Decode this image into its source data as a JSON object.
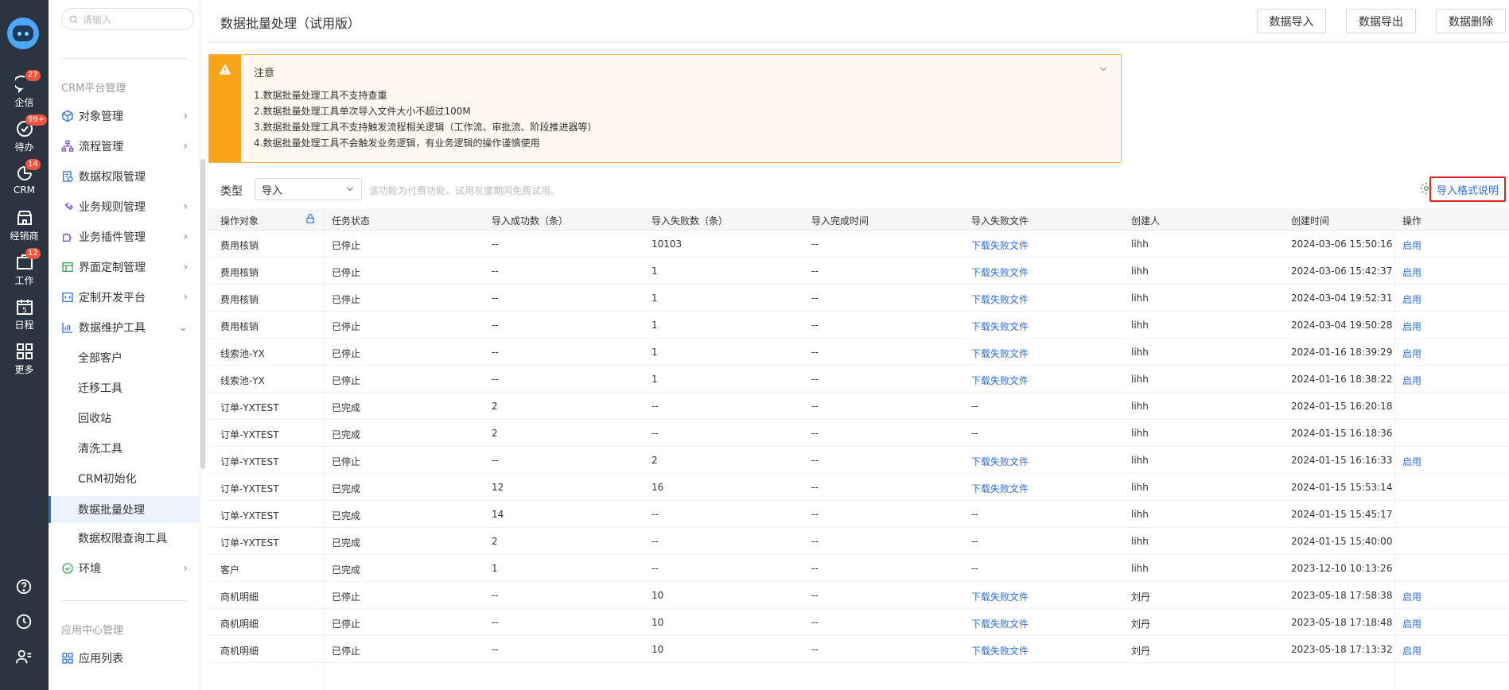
{
  "rail": {
    "items": [
      {
        "label": "企信",
        "badge": "27",
        "icon": "chat-icon"
      },
      {
        "label": "待办",
        "badge": "99+",
        "icon": "check-circle-icon"
      },
      {
        "label": "CRM",
        "badge": "14",
        "icon": "crm-icon"
      },
      {
        "label": "经销商",
        "badge": "",
        "icon": "store-icon"
      },
      {
        "label": "工作",
        "badge": "12",
        "icon": "briefcase-icon"
      },
      {
        "label": "日程",
        "badge": "",
        "icon": "calendar-icon",
        "day": "5"
      },
      {
        "label": "更多",
        "badge": "",
        "icon": "grid-icon"
      }
    ]
  },
  "sidebar": {
    "search_placeholder": "请输入",
    "group1": "CRM平台管理",
    "items": [
      {
        "label": "对象管理",
        "icon": "cube-icon",
        "chev": "›"
      },
      {
        "label": "流程管理",
        "icon": "flow-icon",
        "chev": "›"
      },
      {
        "label": "数据权限管理",
        "icon": "permission-icon",
        "chev": ""
      },
      {
        "label": "业务规则管理",
        "icon": "wrench-icon",
        "chev": "›"
      },
      {
        "label": "业务插件管理",
        "icon": "puzzle-icon",
        "chev": "›"
      },
      {
        "label": "界面定制管理",
        "icon": "layout-icon",
        "chev": "›"
      },
      {
        "label": "定制开发平台",
        "icon": "code-icon",
        "chev": "›"
      },
      {
        "label": "数据维护工具",
        "icon": "chart-icon",
        "chev": "⌄"
      }
    ],
    "subitems": [
      "全部客户",
      "迁移工具",
      "回收站",
      "清洗工具",
      "CRM初始化",
      "数据批量处理",
      "数据权限查询工具"
    ],
    "env": {
      "label": "环境",
      "chev": "›"
    },
    "group2": "应用中心管理",
    "app_list": "应用列表"
  },
  "header": {
    "title": "数据批量处理（试用版）",
    "buttons": [
      "数据导入",
      "数据导出",
      "数据删除"
    ]
  },
  "notice": {
    "title": "注意",
    "lines": [
      "1.数据批量处理工具不支持查重",
      "2.数据批量处理工具单次导入文件大小不超过100M",
      "3.数据批量处理工具不支持触发流程相关逻辑（工作流、审批流、阶段推进器等）",
      "4.数据批量处理工具不会触发业务逻辑，有业务逻辑的操作谨慎使用"
    ]
  },
  "filter": {
    "label": "类型",
    "selected": "导入",
    "hint": "该功能为付费功能，试用灰度期间免费试用。",
    "format_link": "导入格式说明"
  },
  "table": {
    "headers": [
      "操作对象",
      "任务状态",
      "导入成功数（条）",
      "导入失败数（条）",
      "导入完成时间",
      "导入失败文件",
      "创建人",
      "创建时间",
      "操作"
    ],
    "rows": [
      [
        "费用核销",
        "已停止",
        "--",
        "10103",
        "--",
        "下载失败文件",
        "lihh",
        "2024-03-06 15:50:16",
        "启用"
      ],
      [
        "费用核销",
        "已停止",
        "--",
        "1",
        "--",
        "下载失败文件",
        "lihh",
        "2024-03-06 15:42:37",
        "启用"
      ],
      [
        "费用核销",
        "已停止",
        "--",
        "1",
        "--",
        "下载失败文件",
        "lihh",
        "2024-03-04 19:52:31",
        "启用"
      ],
      [
        "费用核销",
        "已停止",
        "--",
        "1",
        "--",
        "下载失败文件",
        "lihh",
        "2024-03-04 19:50:28",
        "启用"
      ],
      [
        "线索池-YX",
        "已停止",
        "--",
        "1",
        "--",
        "下载失败文件",
        "lihh",
        "2024-01-16 18:39:29",
        "启用"
      ],
      [
        "线索池-YX",
        "已停止",
        "--",
        "1",
        "--",
        "下载失败文件",
        "lihh",
        "2024-01-16 18:38:22",
        "启用"
      ],
      [
        "订单-YXTEST",
        "已完成",
        "2",
        "--",
        "--",
        "--",
        "lihh",
        "2024-01-15 16:20:18",
        ""
      ],
      [
        "订单-YXTEST",
        "已完成",
        "2",
        "--",
        "--",
        "--",
        "lihh",
        "2024-01-15 16:18:36",
        ""
      ],
      [
        "订单-YXTEST",
        "已停止",
        "--",
        "2",
        "--",
        "下载失败文件",
        "lihh",
        "2024-01-15 16:16:33",
        "启用"
      ],
      [
        "订单-YXTEST",
        "已完成",
        "12",
        "16",
        "--",
        "下载失败文件",
        "lihh",
        "2024-01-15 15:53:14",
        ""
      ],
      [
        "订单-YXTEST",
        "已完成",
        "14",
        "--",
        "--",
        "--",
        "lihh",
        "2024-01-15 15:45:17",
        ""
      ],
      [
        "订单-YXTEST",
        "已完成",
        "2",
        "--",
        "--",
        "--",
        "lihh",
        "2024-01-15 15:40:00",
        ""
      ],
      [
        "客户",
        "已完成",
        "1",
        "--",
        "--",
        "--",
        "lihh",
        "2023-12-10 10:13:26",
        ""
      ],
      [
        "商机明细",
        "已停止",
        "--",
        "10",
        "--",
        "下载失败文件",
        "刘丹",
        "2023-05-18 17:58:38",
        "启用"
      ],
      [
        "商机明细",
        "已停止",
        "--",
        "10",
        "--",
        "下载失败文件",
        "刘丹",
        "2023-05-18 17:18:48",
        "启用"
      ],
      [
        "商机明细",
        "已停止",
        "--",
        "10",
        "--",
        "下载失败文件",
        "刘丹",
        "2023-05-18 17:13:32",
        "启用"
      ]
    ]
  },
  "colors": {
    "accent": "#2f6fd8",
    "warning": "#faa519",
    "rail": "#2b3542",
    "badge": "#f5533d"
  }
}
